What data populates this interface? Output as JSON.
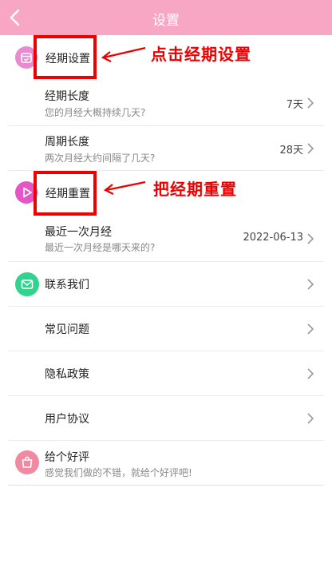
{
  "topbar": {
    "title": "设置",
    "back_icon": "chevron-left-icon"
  },
  "annotations": {
    "click_period": "点击经期设置",
    "reset_period": "把经期重置",
    "color": "#ee0000"
  },
  "period_section": {
    "title": "经期设置",
    "icon": "calendar-icon",
    "icon_color": "#e98ad0",
    "rows": [
      {
        "title": "经期长度",
        "subtitle": "您的月经大概持续几天?",
        "value": "7天"
      },
      {
        "title": "周期长度",
        "subtitle": "两次月经大约间隔了几天?",
        "value": "28天"
      }
    ]
  },
  "reset_section": {
    "title": "经期重置",
    "icon": "play-icon",
    "icon_color": "#e455c6",
    "rows": [
      {
        "title": "最近一次月经",
        "subtitle": "最近一次月经是哪天来的?",
        "value": "2022-06-13"
      }
    ]
  },
  "menu": {
    "contact": {
      "label": "联系我们",
      "icon": "mail-icon",
      "icon_color": "#31d38e"
    },
    "faq": {
      "label": "常见问题"
    },
    "privacy": {
      "label": "隐私政策"
    },
    "agreement": {
      "label": "用户协议"
    }
  },
  "rate": {
    "title": "给个好评",
    "subtitle": "感觉我们做的不错，就给个好评吧!",
    "icon": "shopping-bag-icon",
    "icon_color": "#f08aa2"
  },
  "colors": {
    "topbar": "#f7a6c4",
    "accent_red": "#ee0000"
  }
}
